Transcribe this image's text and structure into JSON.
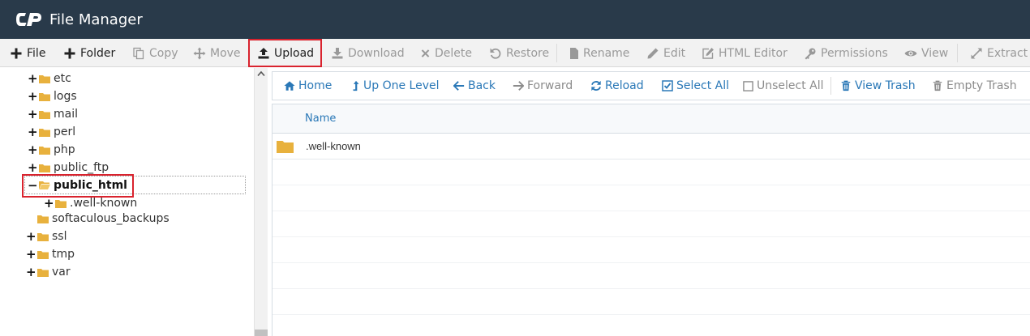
{
  "header": {
    "title": "File Manager"
  },
  "toolbar": {
    "file": "File",
    "folder": "Folder",
    "copy": "Copy",
    "move": "Move",
    "upload": "Upload",
    "download": "Download",
    "delete": "Delete",
    "restore": "Restore",
    "rename": "Rename",
    "edit": "Edit",
    "html_editor": "HTML Editor",
    "permissions": "Permissions",
    "view": "View",
    "extract": "Extract"
  },
  "tree": {
    "items": [
      {
        "label": "etc"
      },
      {
        "label": "logs"
      },
      {
        "label": "mail"
      },
      {
        "label": "perl"
      },
      {
        "label": "php"
      },
      {
        "label": "public_ftp"
      },
      {
        "label": "public_html"
      },
      {
        "label": ".well-known"
      },
      {
        "label": "softaculous_backups"
      },
      {
        "label": "ssl"
      },
      {
        "label": "tmp"
      },
      {
        "label": "var"
      }
    ]
  },
  "nav": {
    "home": "Home",
    "up": "Up One Level",
    "back": "Back",
    "forward": "Forward",
    "reload": "Reload",
    "select_all": "Select All",
    "unselect_all": "Unselect All",
    "view_trash": "View Trash",
    "empty_trash": "Empty Trash"
  },
  "list": {
    "column_name": "Name",
    "rows": [
      {
        "name": ".well-known"
      }
    ]
  },
  "colors": {
    "header": "#293a4a",
    "link": "#2a78b7",
    "highlight": "#d9232e",
    "folder": "#e8b13d"
  }
}
